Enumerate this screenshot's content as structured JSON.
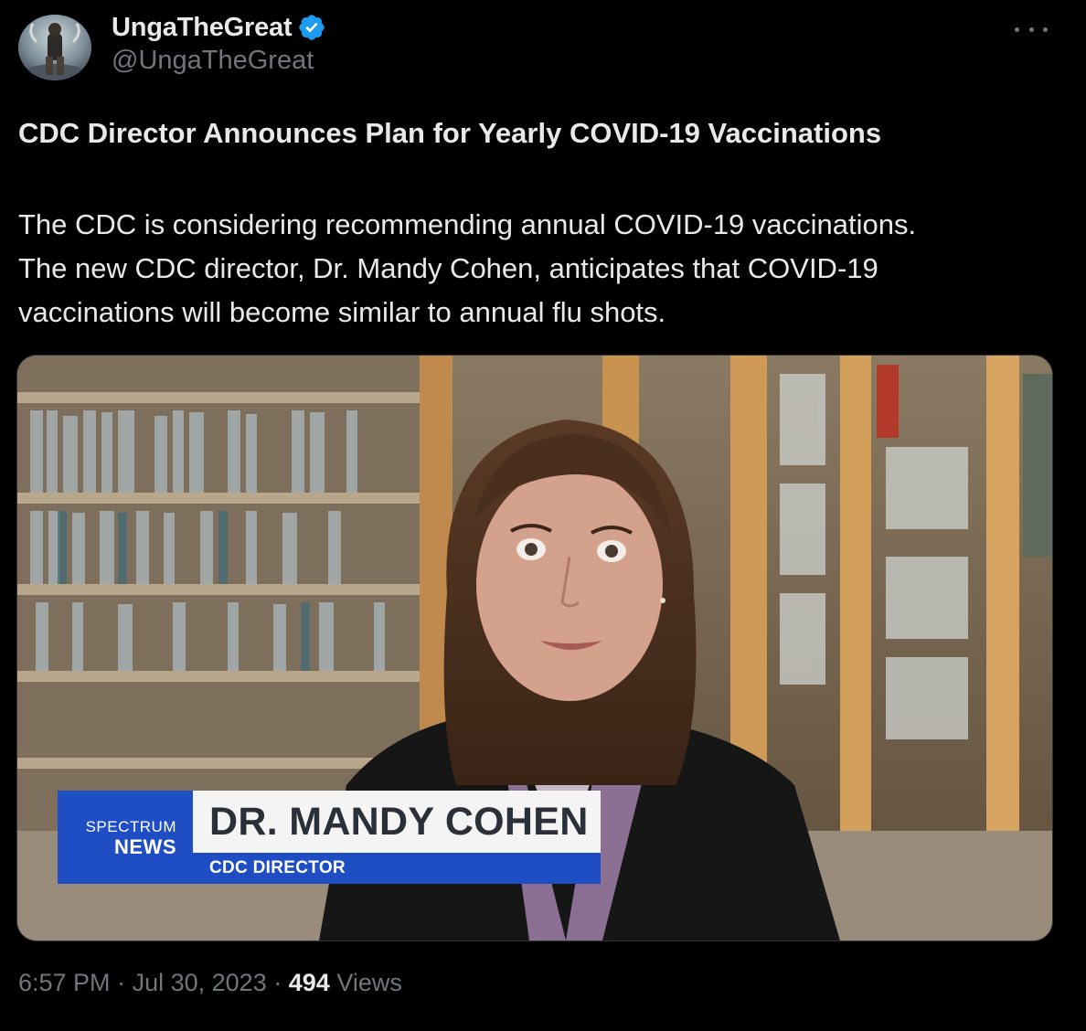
{
  "author": {
    "display_name": "UngaTheGreat",
    "handle": "@UngaTheGreat",
    "verified": true,
    "verified_color": "#1d9bf0"
  },
  "tweet": {
    "headline": "CDC Director Announces Plan for Yearly COVID-19 Vaccinations",
    "body_lines": [
      "The CDC is considering recommending annual COVID-19 vaccinations.",
      "The new CDC director, Dr. Mandy Cohen, anticipates that COVID-19",
      "vaccinations will become similar to annual flu shots."
    ]
  },
  "media": {
    "kind": "video-frame",
    "lower_third": {
      "brand_top": "SPECTRUM",
      "brand_bottom": "NEWS",
      "name": "DR. MANDY COHEN",
      "title": "CDC DIRECTOR",
      "brand_color": "#1f4ec4"
    }
  },
  "meta": {
    "time": "6:57 PM",
    "separator": "·",
    "date": "Jul 30, 2023",
    "views_count": "494",
    "views_label": "Views"
  },
  "icons": {
    "more": "more-horizontal-icon",
    "verified": "verified-badge-icon"
  },
  "colors": {
    "background": "#000000",
    "text_primary": "#e7e9ea",
    "text_secondary": "#71767b"
  }
}
